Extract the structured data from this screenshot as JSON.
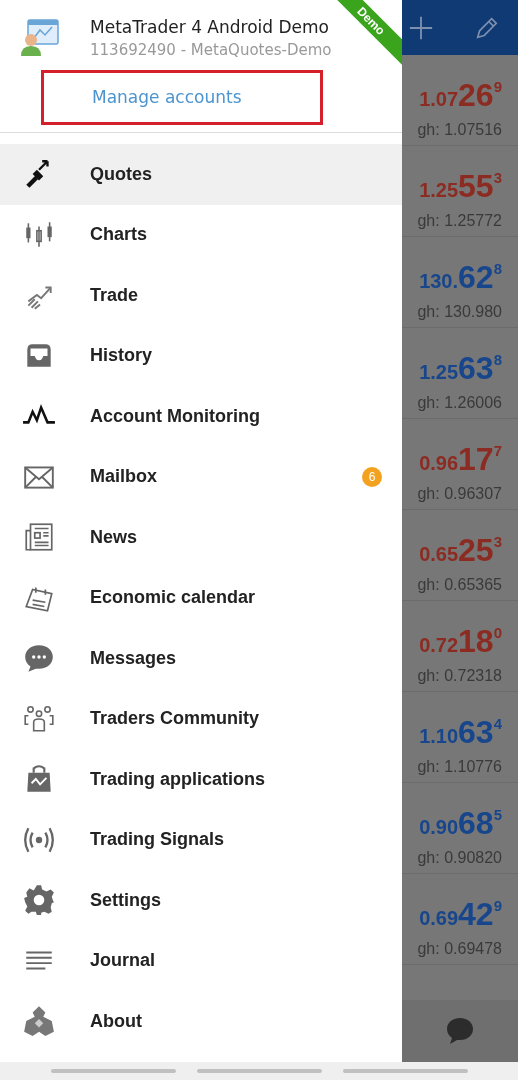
{
  "account": {
    "title": "MetaTrader 4 Android Demo",
    "subtitle": "113692490 - MetaQuotes-Demo",
    "manage_label": "Manage accounts",
    "highlighted": true
  },
  "ribbon": "Demo",
  "menu": [
    {
      "label": "Quotes",
      "selected": true
    },
    {
      "label": "Charts",
      "selected": false
    },
    {
      "label": "Trade",
      "selected": false
    },
    {
      "label": "History",
      "selected": false
    },
    {
      "label": "Account Monitoring",
      "selected": false
    },
    {
      "label": "Mailbox",
      "selected": false,
      "badge": "6"
    },
    {
      "label": "News",
      "selected": false
    },
    {
      "label": "Economic calendar",
      "selected": false
    },
    {
      "label": "Messages",
      "selected": false
    },
    {
      "label": "Traders Community",
      "selected": false
    },
    {
      "label": "Trading applications",
      "selected": false
    },
    {
      "label": "Trading Signals",
      "selected": false
    },
    {
      "label": "Settings",
      "selected": false
    },
    {
      "label": "Journal",
      "selected": false
    },
    {
      "label": "About",
      "selected": false
    }
  ],
  "quotes": [
    {
      "lead": "1.07",
      "big": "26",
      "sup": "9",
      "high": "gh: 1.07516",
      "color": "#8c2b22"
    },
    {
      "lead": "1.25",
      "big": "55",
      "sup": "3",
      "high": "gh: 1.25772",
      "color": "#8c2b22"
    },
    {
      "lead": "130.",
      "big": "62",
      "sup": "8",
      "high": "gh: 130.980",
      "color": "#17468c"
    },
    {
      "lead": "1.25",
      "big": "63",
      "sup": "8",
      "high": "gh: 1.26006",
      "color": "#17468c"
    },
    {
      "lead": "0.96",
      "big": "17",
      "sup": "7",
      "high": "gh: 0.96307",
      "color": "#8c2b22"
    },
    {
      "lead": "0.65",
      "big": "25",
      "sup": "3",
      "high": "gh: 0.65365",
      "color": "#8c2b22"
    },
    {
      "lead": "0.72",
      "big": "18",
      "sup": "0",
      "high": "gh: 0.72318",
      "color": "#8c2b22"
    },
    {
      "lead": "1.10",
      "big": "63",
      "sup": "4",
      "high": "gh: 1.10776",
      "color": "#17468c"
    },
    {
      "lead": "0.90",
      "big": "68",
      "sup": "5",
      "high": "gh: 0.90820",
      "color": "#17468c"
    },
    {
      "lead": "0.69",
      "big": "42",
      "sup": "9",
      "high": "gh: 0.69478",
      "color": "#17468c"
    }
  ]
}
